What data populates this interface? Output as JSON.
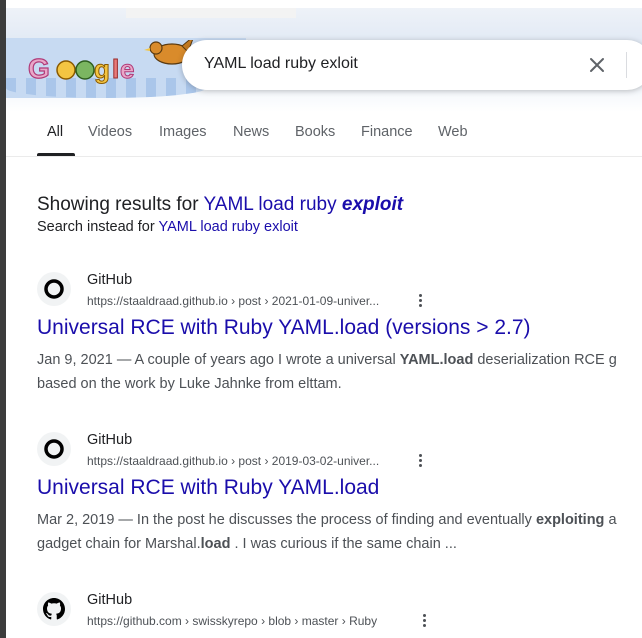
{
  "search": {
    "query": "YAML load ruby exloit"
  },
  "logo": {
    "alt": "Google"
  },
  "tabs": [
    {
      "label": "All",
      "active": true
    },
    {
      "label": "Videos"
    },
    {
      "label": "Images"
    },
    {
      "label": "News"
    },
    {
      "label": "Books"
    },
    {
      "label": "Finance"
    },
    {
      "label": "Web"
    }
  ],
  "correction": {
    "showing_prefix": "Showing results for",
    "corrected_plain": "YAML load ruby",
    "corrected_emph": "exploit",
    "instead_prefix": "Search instead for",
    "original_query": "YAML load ruby exloit"
  },
  "results": [
    {
      "site": "GitHub",
      "url": "https://staaldraad.github.io › post › 2021-01-09-univer...",
      "title": "Universal RCE with Ruby YAML.load (versions > 2.7)",
      "snippet_line1_a": "Jan 9, 2021 — A couple of years ago I wrote a universal ",
      "snippet_line1_b": "YAML.load",
      "snippet_line1_c": " deserialization RCE g",
      "snippet_line2": "based on the work by Luke Jahnke from elttam.",
      "icon": "circle-o-icon"
    },
    {
      "site": "GitHub",
      "url": "https://staaldraad.github.io › post › 2019-03-02-univer...",
      "title": "Universal RCE with Ruby YAML.load",
      "snippet_line1_a": "Mar 2, 2019 — In the post he discusses the process of finding and eventually ",
      "snippet_line1_b": "exploiting",
      "snippet_line1_c": " a",
      "snippet_line2_a": "gadget chain for Marshal.",
      "snippet_line2_b": "load",
      "snippet_line2_c": " . I was curious if the same chain ...",
      "icon": "circle-o-icon"
    },
    {
      "site": "GitHub",
      "url": "https://github.com › swisskyrepo › blob › master › Ruby",
      "icon": "github-icon"
    }
  ],
  "colors": {
    "link": "#1a0dab",
    "text": "#202124",
    "muted": "#4d5156"
  }
}
